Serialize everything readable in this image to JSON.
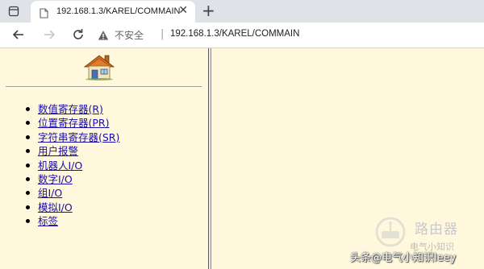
{
  "tab": {
    "title": "192.168.1.3/KAREL/COMMAIN",
    "close_glyph": "✕",
    "new_tab_glyph": "+"
  },
  "toolbar": {
    "back_icon": "back-arrow-icon",
    "forward_icon": "forward-arrow-icon",
    "reload_icon": "reload-icon",
    "security_icon": "warning-icon",
    "security_text": "不安全",
    "separator": "|",
    "url": "192.168.1.3/KAREL/COMMAIN"
  },
  "left_frame": {
    "logo_icon": "home-icon",
    "menu": [
      {
        "label": "数值寄存器(R)"
      },
      {
        "label": "位置寄存器(PR)"
      },
      {
        "label": "字符串寄存器(SR)"
      },
      {
        "label": "用户报警"
      },
      {
        "label": "机器人I/O"
      },
      {
        "label": "数字I/O"
      },
      {
        "label": "组I/O"
      },
      {
        "label": "模拟I/O"
      },
      {
        "label": "标签"
      }
    ]
  },
  "watermark": {
    "brand": "路由器",
    "sub": "电气小知识",
    "credit": "头条@电气小知识leey"
  },
  "colors": {
    "frame_background": "#fff8dc",
    "link": "#1a0dab",
    "tab_strip": "#dfe3e8"
  }
}
